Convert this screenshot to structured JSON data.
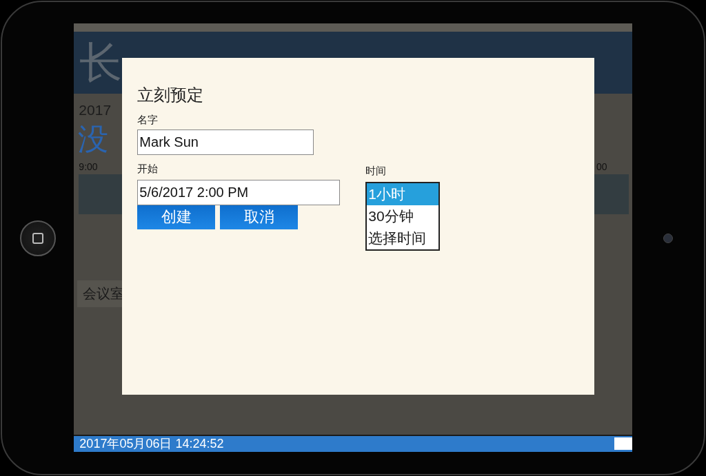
{
  "background_page": {
    "title": "长",
    "date": "2017",
    "status": "没",
    "timeline_start": "9:00",
    "timeline_end": "00",
    "room_label": "会议室",
    "footer_clock": "2017年05月06日 14:24:52"
  },
  "dialog": {
    "title": "立刻预定",
    "name_label": "名字",
    "name_value": "Mark Sun",
    "start_label": "开始",
    "start_value": "5/6/2017 2:00 PM",
    "duration_label": "时间",
    "duration_options": [
      {
        "label": "1小时",
        "selected": true
      },
      {
        "label": "30分钟",
        "selected": false
      },
      {
        "label": "选择时间",
        "selected": false
      }
    ],
    "buttons": [
      "创建",
      "取消"
    ]
  }
}
